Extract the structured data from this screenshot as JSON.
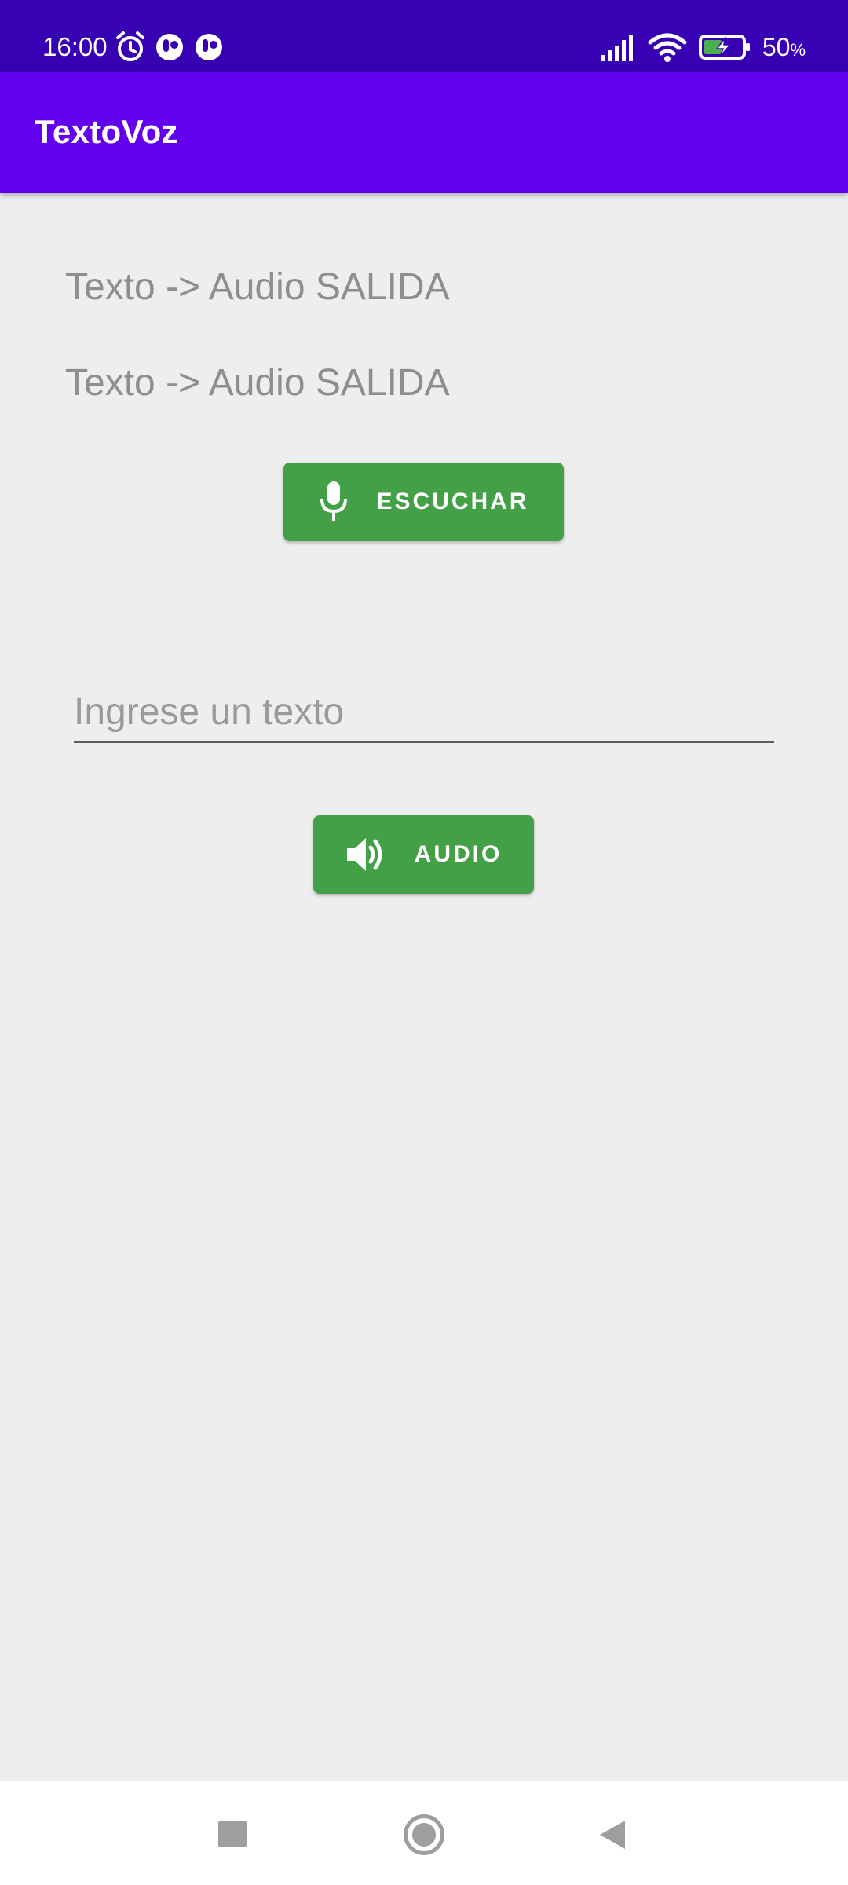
{
  "status_bar": {
    "time": "16:00",
    "battery_value": "50",
    "battery_unit": "%",
    "icons": [
      "alarm-icon",
      "app-notification-icon",
      "app-notification-icon",
      "signal-icon",
      "wifi-icon",
      "battery-charging-icon"
    ]
  },
  "app_bar": {
    "title": "TextoVoz"
  },
  "main": {
    "output_line_1": "Texto -> Audio SALIDA",
    "output_line_2": "Texto -> Audio SALIDA",
    "listen_button": {
      "label": "ESCUCHAR",
      "icon": "microphone-icon"
    },
    "text_input": {
      "placeholder": "Ingrese un texto",
      "value": ""
    },
    "audio_button": {
      "label": "AUDIO",
      "icon": "speaker-icon"
    }
  },
  "nav_bar": {
    "buttons": [
      "recents-icon",
      "home-icon",
      "back-icon"
    ]
  },
  "colors": {
    "status_bar": "#3700b3",
    "app_bar": "#6200ee",
    "button": "#43a047",
    "background": "#eeeeee",
    "output_text": "#8e8e8e"
  }
}
